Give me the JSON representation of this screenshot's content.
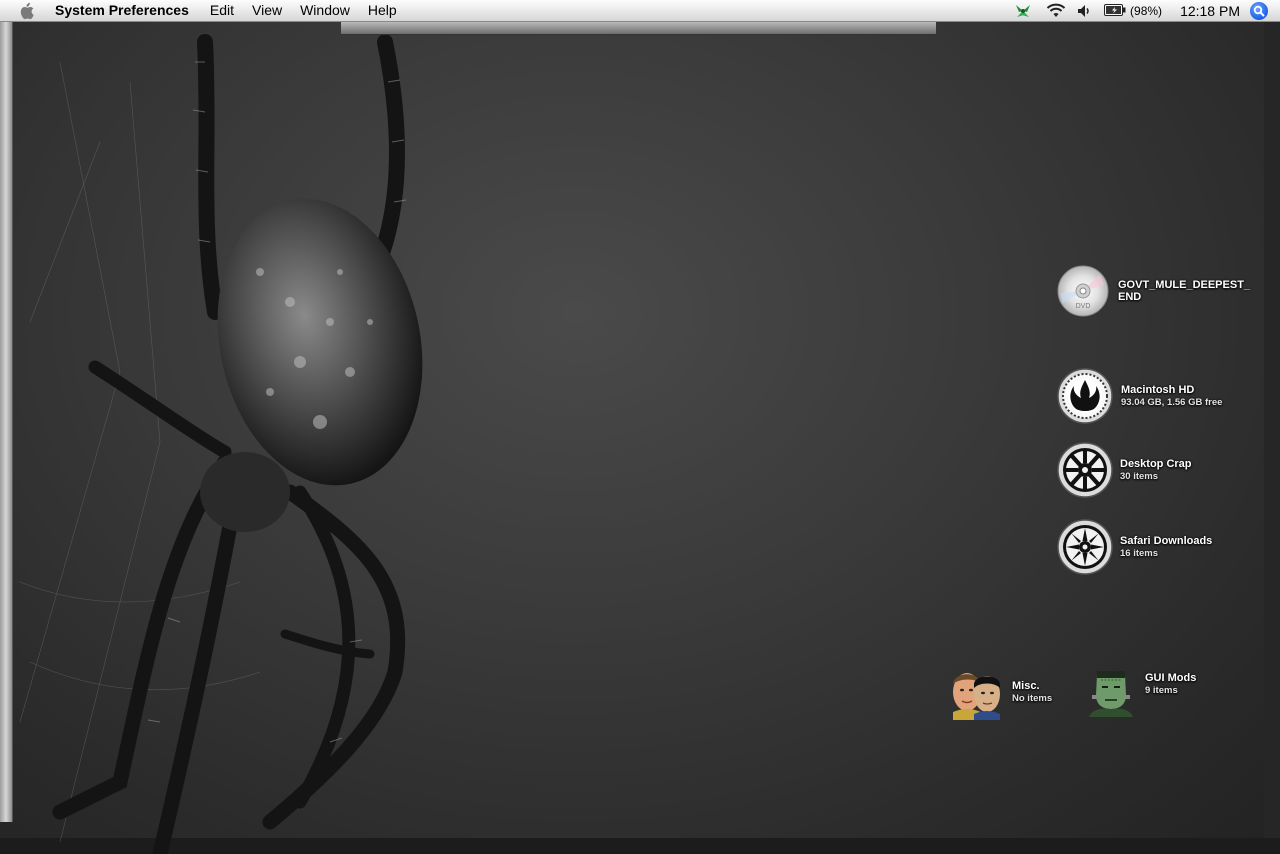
{
  "menubar": {
    "app_name": "System Preferences",
    "menus": [
      "Edit",
      "View",
      "Window",
      "Help"
    ],
    "battery": "(98%)",
    "clock": "12:18 PM"
  },
  "desktop_icons": {
    "dvd": {
      "label_line1": "GOVT_MULE_DEEPEST_",
      "label_line2": "END",
      "disc_text": "DVD"
    },
    "macintosh_hd": {
      "label": "Macintosh HD",
      "info": "93.04 GB, 1.56 GB free"
    },
    "desktop_crap": {
      "label": "Desktop Crap",
      "info": "30 items"
    },
    "safari_downloads": {
      "label": "Safari Downloads",
      "info": "16 items"
    },
    "misc": {
      "label": "Misc.",
      "info": "No items"
    },
    "gui_mods": {
      "label": "GUI Mods",
      "info": "9 items"
    }
  },
  "colors": {
    "menubar": "#ececec",
    "spotlight": "#1b5fe0",
    "desktop": "#3a3a3a"
  }
}
